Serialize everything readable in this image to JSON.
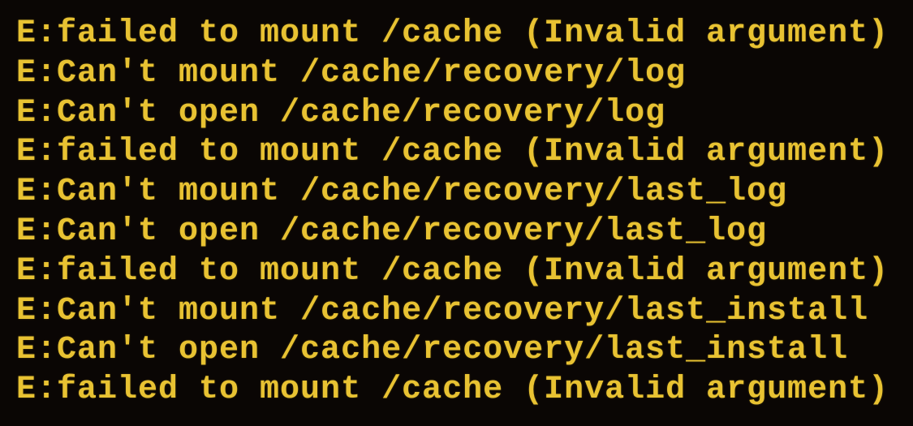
{
  "terminal": {
    "lines": [
      "E:failed to mount /cache (Invalid argument)",
      "E:Can't mount /cache/recovery/log",
      "E:Can't open /cache/recovery/log",
      "E:failed to mount /cache (Invalid argument)",
      "E:Can't mount /cache/recovery/last_log",
      "E:Can't open /cache/recovery/last_log",
      "E:failed to mount /cache (Invalid argument)",
      "E:Can't mount /cache/recovery/last_install",
      "E:Can't open /cache/recovery/last_install",
      "E:failed to mount /cache (Invalid argument)"
    ]
  },
  "colors": {
    "background": "#0a0604",
    "text": "#e8c232"
  }
}
